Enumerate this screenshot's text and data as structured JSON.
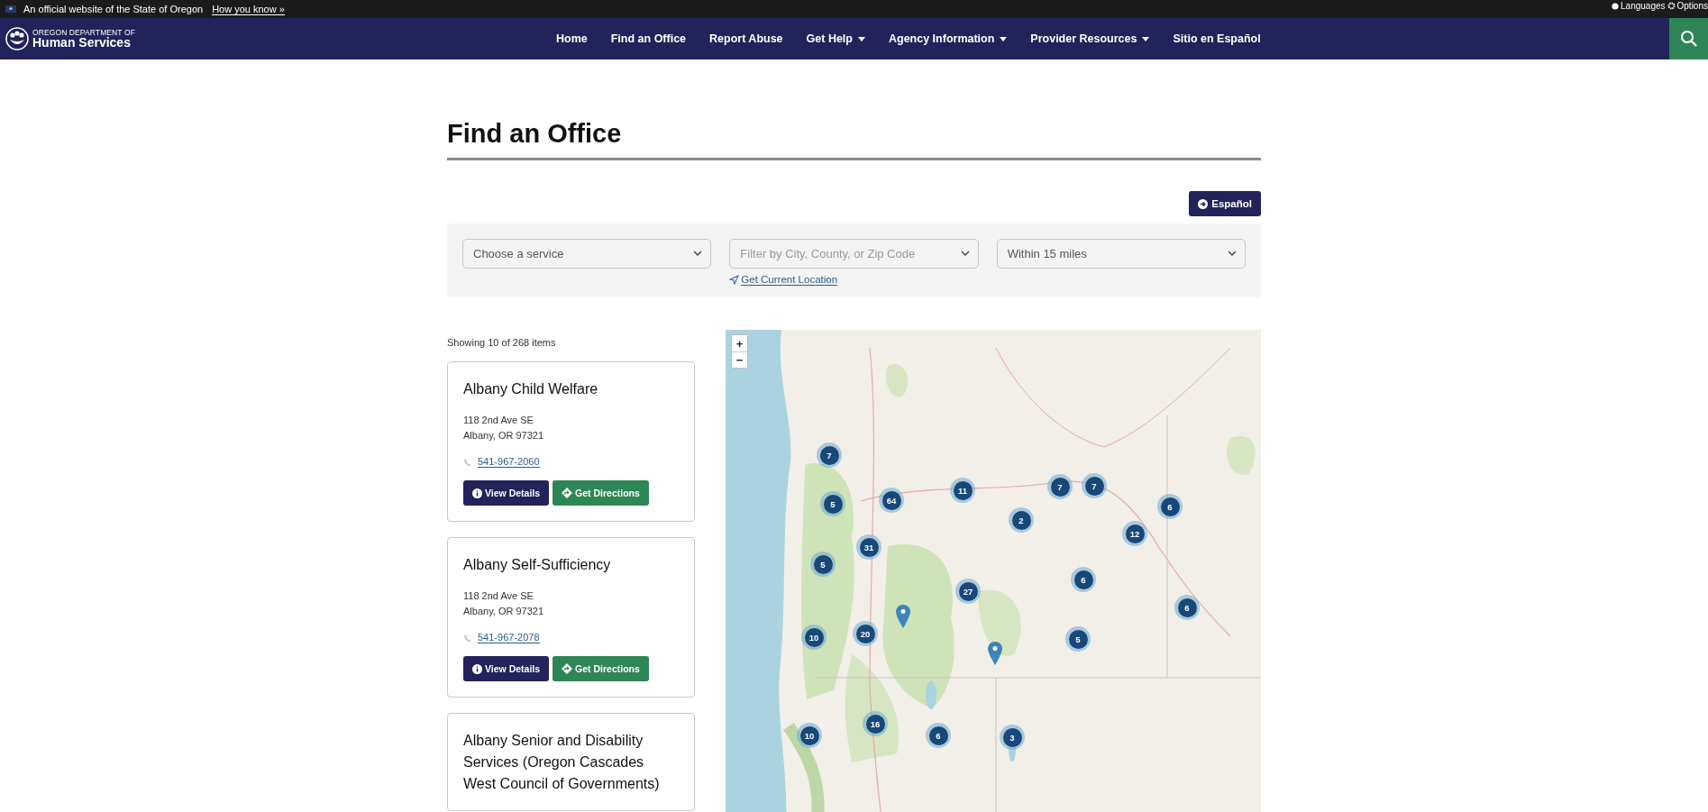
{
  "official_banner": {
    "text": "An official website of the State of Oregon",
    "link": "How you know »",
    "languages": "Languages",
    "options": "Options"
  },
  "header": {
    "logo_top": "OREGON DEPARTMENT OF",
    "logo_bottom": "Human Services",
    "nav": [
      {
        "label": "Home",
        "dropdown": false
      },
      {
        "label": "Find an Office",
        "dropdown": false
      },
      {
        "label": "Report Abuse",
        "dropdown": false
      },
      {
        "label": "Get Help",
        "dropdown": true
      },
      {
        "label": "Agency Information",
        "dropdown": true
      },
      {
        "label": "Provider Resources",
        "dropdown": true
      },
      {
        "label": "Sitio en Español",
        "dropdown": false
      }
    ]
  },
  "page": {
    "title": "Find an Office",
    "language_button": "Español"
  },
  "filters": [
    {
      "value": "Choose a service"
    },
    {
      "placeholder": "Filter by City, County, or Zip Code"
    },
    {
      "value": "Within 15 miles"
    }
  ],
  "location_link": "Get Current Location",
  "results": {
    "count": "Showing 10 of 268 items",
    "offices": [
      {
        "name": "Albany Child Welfare",
        "address_line1": "118 2nd Ave SE",
        "address_line2": "Albany, OR 97321",
        "phone": "541-967-2060",
        "details_button": "View Details",
        "directions_button": "Get Directions"
      },
      {
        "name": "Albany Self-Sufficiency",
        "address_line1": "118 2nd Ave SE",
        "address_line2": "Albany, OR 97321",
        "phone": "541-967-2078",
        "details_button": "View Details",
        "directions_button": "Get Directions"
      },
      {
        "name": "Albany Senior and Disability Services (Oregon Cascades West Council of Governments)"
      }
    ]
  },
  "map": {
    "zoom_in": "+",
    "zoom_out": "−",
    "markers": [
      {
        "kind": "cluster",
        "count": "7"
      },
      {
        "kind": "cluster",
        "count": "5"
      },
      {
        "kind": "cluster",
        "count": "64"
      },
      {
        "kind": "cluster",
        "count": "11"
      },
      {
        "kind": "cluster",
        "count": "7"
      },
      {
        "kind": "cluster",
        "count": "7"
      },
      {
        "kind": "cluster",
        "count": "6"
      },
      {
        "kind": "cluster",
        "count": "2"
      },
      {
        "kind": "cluster",
        "count": "12"
      },
      {
        "kind": "cluster",
        "count": "31"
      },
      {
        "kind": "cluster",
        "count": "5"
      },
      {
        "kind": "cluster",
        "count": "6"
      },
      {
        "kind": "cluster",
        "count": "27"
      },
      {
        "kind": "cluster",
        "count": "6"
      },
      {
        "kind": "cluster",
        "count": "10"
      },
      {
        "kind": "cluster",
        "count": "20"
      },
      {
        "kind": "cluster",
        "count": "5"
      },
      {
        "kind": "cluster",
        "count": "16"
      },
      {
        "kind": "cluster",
        "count": "10"
      },
      {
        "kind": "cluster",
        "count": "6"
      },
      {
        "kind": "cluster",
        "count": "3"
      },
      {
        "kind": "pin"
      },
      {
        "kind": "pin"
      }
    ]
  }
}
